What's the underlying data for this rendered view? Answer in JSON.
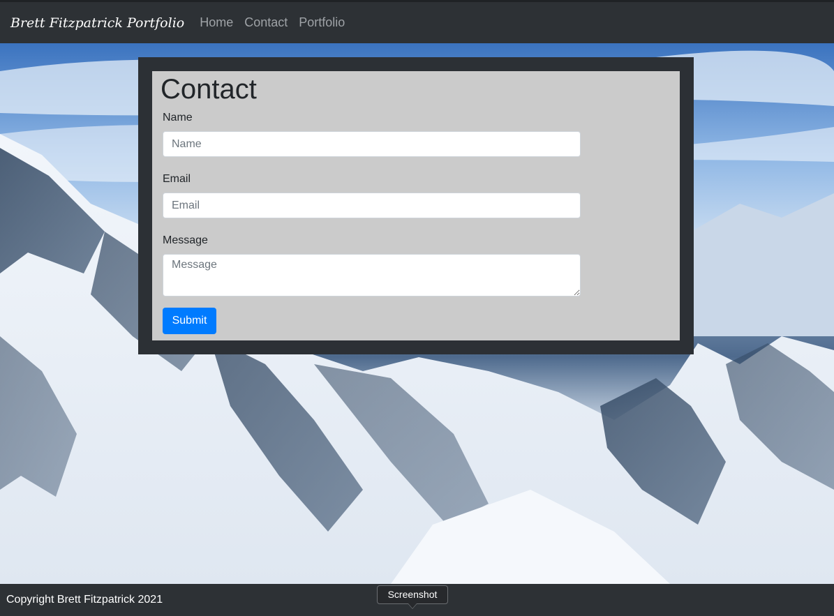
{
  "navbar": {
    "brand": "Brett Fitzpatrick Portfolio",
    "links": [
      {
        "label": "Home"
      },
      {
        "label": "Contact"
      },
      {
        "label": "Portfolio"
      }
    ]
  },
  "contact": {
    "title": "Contact",
    "fields": {
      "name": {
        "label": "Name",
        "placeholder": "Name",
        "value": ""
      },
      "email": {
        "label": "Email",
        "placeholder": "Email",
        "value": ""
      },
      "message": {
        "label": "Message",
        "placeholder": "Message",
        "value": ""
      }
    },
    "submit_label": "Submit"
  },
  "footer": {
    "copyright": "Copyright Brett Fitzpatrick 2021"
  },
  "tooltip": {
    "text": "Screenshot"
  },
  "colors": {
    "navbar_bg": "#2d3135",
    "card_bg": "#cbcbcb",
    "button_primary": "#007bff"
  },
  "background_image": {
    "subject": "snowy-mountain-range"
  }
}
